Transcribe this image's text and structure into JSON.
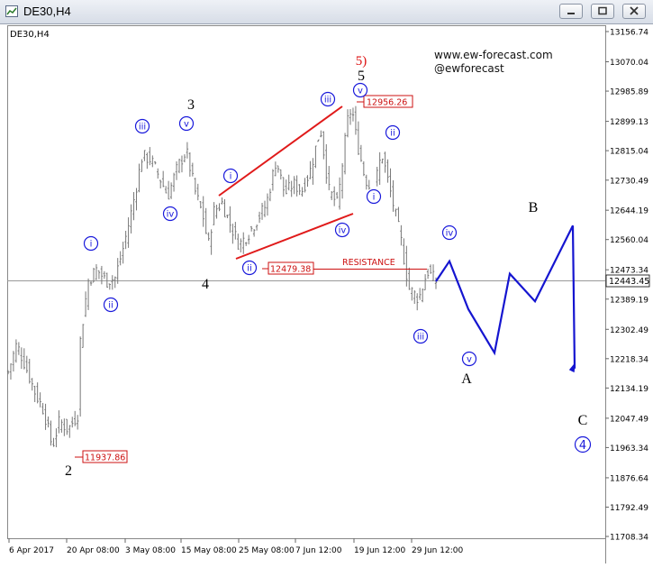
{
  "window": {
    "title": "DE30,H4",
    "buttons": [
      {
        "name": "minimize",
        "icon": "minimize-icon"
      },
      {
        "name": "maximize",
        "icon": "maximize-icon"
      },
      {
        "name": "close",
        "icon": "close-icon"
      }
    ]
  },
  "chart_label": "DE30,H4",
  "watermark": {
    "site": "www.ew-forecast.com",
    "handle": "@ewforecast"
  },
  "colors": {
    "wave_blue": "#1a1adb",
    "forecast_blue": "#1515d0",
    "trendline_red": "#e01a1a",
    "price_box_red": "#cc1111",
    "candles": "#777777"
  },
  "chart_data": {
    "type": "line",
    "title": "DE30,H4",
    "instrument": "DE30",
    "timeframe": "H4",
    "grid": false,
    "ylim": [
      11708.34,
      13156.74
    ],
    "y_tick_labels": [
      "13156.74",
      "13070.04",
      "12985.89",
      "12899.13",
      "12815.04",
      "12730.49",
      "12644.19",
      "12560.04",
      "12473.34",
      "12389.19",
      "12302.49",
      "12218.34",
      "12134.19",
      "12047.49",
      "11963.34",
      "11876.64",
      "11792.49",
      "11708.34"
    ],
    "x_tick_labels": [
      "6 Apr 2017",
      "20 Apr 08:00",
      "3 May 08:00",
      "15 May 08:00",
      "25 May 08:00",
      "7 Jun 12:00",
      "19 Jun 12:00",
      "29 Jun 12:00"
    ],
    "current_price": "12443.45",
    "price_labels": [
      {
        "value": 12956.26,
        "text": "12956.26"
      },
      {
        "value": 12479.38,
        "text": "12479.38"
      },
      {
        "value": 11937.86,
        "text": "11937.86"
      }
    ],
    "resistance": {
      "label": "RESISTANCE",
      "value": 12479.38
    },
    "price_path": [
      [
        0,
        12180
      ],
      [
        0.6,
        12260
      ],
      [
        1.2,
        12200
      ],
      [
        1.9,
        12120
      ],
      [
        2.5,
        12070
      ],
      [
        3.1,
        11965
      ],
      [
        3.6,
        12040
      ],
      [
        4.2,
        12015
      ],
      [
        4.9,
        12060
      ],
      [
        5.0,
        12250
      ],
      [
        5.6,
        12440
      ],
      [
        6.2,
        12475
      ],
      [
        6.9,
        12440
      ],
      [
        7.5,
        12450
      ],
      [
        8.1,
        12540
      ],
      [
        8.7,
        12650
      ],
      [
        9.4,
        12800
      ],
      [
        10.0,
        12790
      ],
      [
        10.6,
        12740
      ],
      [
        11.2,
        12685
      ],
      [
        11.9,
        12770
      ],
      [
        12.5,
        12815
      ],
      [
        13.1,
        12700
      ],
      [
        13.8,
        12610
      ],
      [
        14.0,
        12530
      ],
      [
        14.4,
        12640
      ],
      [
        15.0,
        12665
      ],
      [
        15.6,
        12600
      ],
      [
        16.2,
        12545
      ],
      [
        16.9,
        12580
      ],
      [
        17.5,
        12620
      ],
      [
        18.1,
        12660
      ],
      [
        18.8,
        12790
      ],
      [
        19.4,
        12690
      ],
      [
        20.0,
        12720
      ],
      [
        20.6,
        12700
      ],
      [
        21.2,
        12760
      ],
      [
        21.9,
        12880
      ],
      [
        22.5,
        12700
      ],
      [
        23.1,
        12660
      ],
      [
        23.8,
        12900
      ],
      [
        24.1,
        12940
      ],
      [
        24.4,
        12855
      ],
      [
        25.0,
        12740
      ],
      [
        25.6,
        12690
      ],
      [
        26.2,
        12810
      ],
      [
        26.9,
        12680
      ],
      [
        27.5,
        12570
      ],
      [
        28.1,
        12420
      ],
      [
        28.8,
        12390
      ],
      [
        29.4,
        12470
      ],
      [
        30.0,
        12440
      ]
    ],
    "wave_labels": [
      {
        "text": "2",
        "degree": "primary"
      },
      {
        "text": "i",
        "degree": "minute",
        "circled": true
      },
      {
        "text": "ii",
        "degree": "minute",
        "circled": true
      },
      {
        "text": "iii",
        "degree": "minute",
        "circled": true
      },
      {
        "text": "iv",
        "degree": "minute",
        "circled": true
      },
      {
        "text": "v",
        "degree": "minute",
        "circled": true
      },
      {
        "text": "3",
        "degree": "primary"
      },
      {
        "text": "4",
        "degree": "primary"
      },
      {
        "text": "i",
        "degree": "minute",
        "circled": true
      },
      {
        "text": "ii",
        "degree": "minute",
        "circled": true
      },
      {
        "text": "iii",
        "degree": "minute",
        "circled": true
      },
      {
        "text": "iv",
        "degree": "minute",
        "circled": true
      },
      {
        "text": "v",
        "degree": "minute",
        "circled": true
      },
      {
        "text": "5",
        "degree": "primary"
      },
      {
        "text": "5)",
        "degree": "intermediate"
      },
      {
        "text": "i",
        "degree": "minute",
        "circled": true
      },
      {
        "text": "ii",
        "degree": "minute",
        "circled": true
      },
      {
        "text": "iii",
        "degree": "minute",
        "circled": true
      },
      {
        "text": "iv",
        "degree": "minute",
        "circled": true
      },
      {
        "text": "v",
        "degree": "minute",
        "circled": true
      },
      {
        "text": "A",
        "degree": "primary"
      },
      {
        "text": "B",
        "degree": "primary"
      },
      {
        "text": "C",
        "degree": "primary"
      },
      {
        "text": "4",
        "degree": "primary",
        "circled": true
      }
    ],
    "forecast_path": [
      12440,
      12498,
      12360,
      12235,
      12462,
      12383,
      12600,
      12190
    ]
  }
}
